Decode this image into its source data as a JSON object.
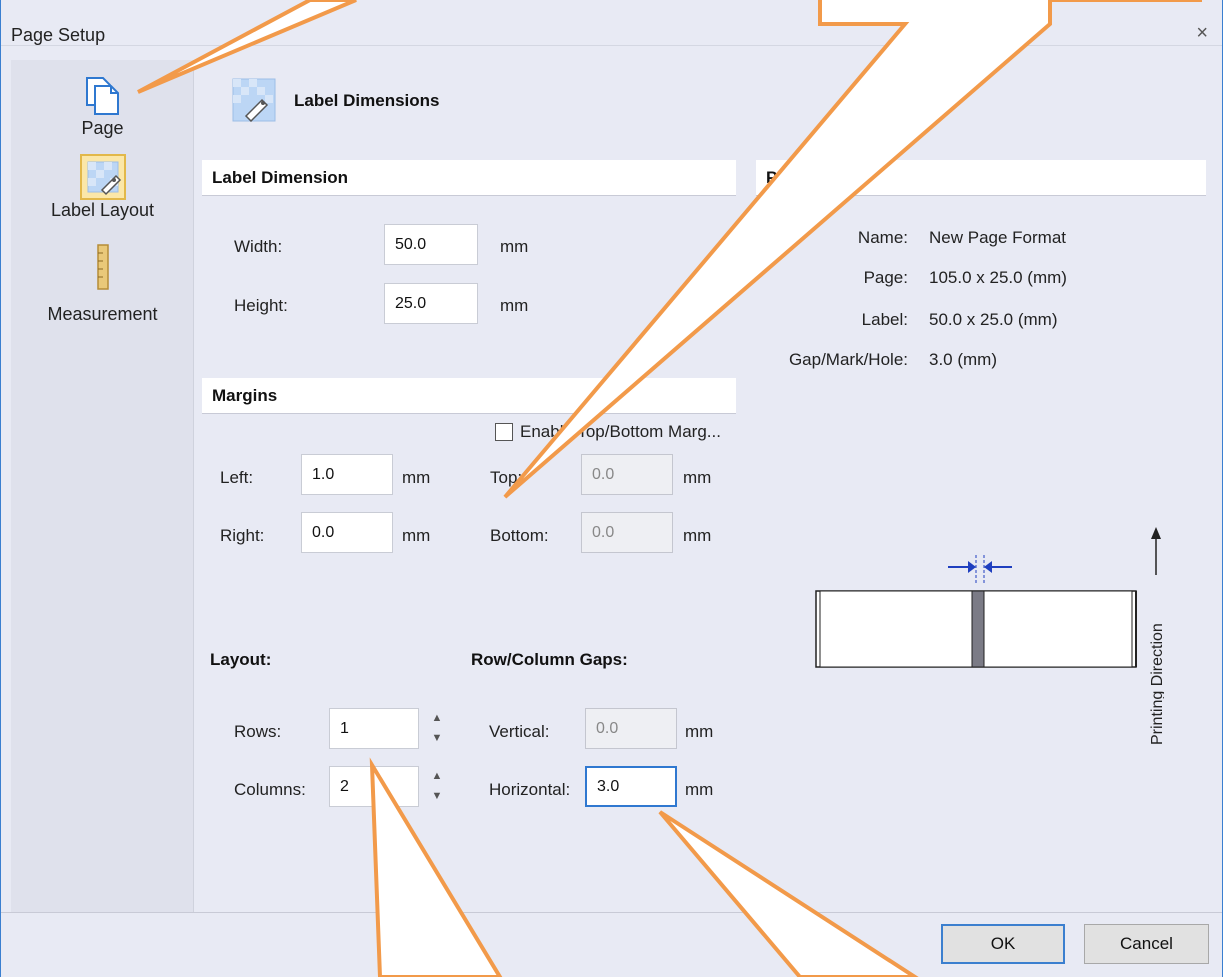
{
  "window": {
    "title": "Page Setup",
    "close_glyph": "×"
  },
  "sidebar": {
    "items": [
      {
        "label": "Page",
        "icon": "page-icon"
      },
      {
        "label": "Label Layout",
        "icon": "label-layout-icon",
        "selected": true
      },
      {
        "label": "Measurement",
        "icon": "ruler-icon"
      }
    ]
  },
  "header": {
    "title": "Label Dimensions",
    "icon": "label-dimensions-icon"
  },
  "label_dimension": {
    "title": "Label Dimension",
    "width_label": "Width:",
    "width_value": "50.0",
    "width_unit": "mm",
    "height_label": "Height:",
    "height_value": "25.0",
    "height_unit": "mm"
  },
  "margins": {
    "title": "Margins",
    "enable_label": "Enable Top/Bottom Marg...",
    "enable_checked": false,
    "left_label": "Left:",
    "left_value": "1.0",
    "left_unit": "mm",
    "right_label": "Right:",
    "right_value": "0.0",
    "right_unit": "mm",
    "top_label": "Top:",
    "top_value": "0.0",
    "top_unit": "mm",
    "bottom_label": "Bottom:",
    "bottom_value": "0.0",
    "bottom_unit": "mm"
  },
  "layout": {
    "title": "Layout:",
    "rows_label": "Rows:",
    "rows_value": "1",
    "columns_label": "Columns:",
    "columns_value": "2",
    "spin_up": "▲",
    "spin_down": "▼"
  },
  "gaps": {
    "title": "Row/Column Gaps:",
    "vertical_label": "Vertical:",
    "vertical_value": "0.0",
    "vertical_unit": "mm",
    "horizontal_label": "Horizontal:",
    "horizontal_value": "3.0",
    "horizontal_unit": "mm"
  },
  "preview": {
    "title_left": "P",
    "title_right": "iew",
    "name_label": "Name:",
    "name_value": "New Page Format",
    "page_label": "Page:",
    "page_value": "105.0 x 25.0 (mm)",
    "label_label": "Label:",
    "label_value": "50.0 x 25.0 (mm)",
    "gap_label": "Gap/Mark/Hole:",
    "gap_value": "3.0 (mm)",
    "direction_label": "Printing Direction"
  },
  "footer": {
    "ok_label": "OK",
    "cancel_label": "Cancel"
  },
  "colors": {
    "accent": "#2f78d0",
    "callout": "#f29a4a",
    "window_bg": "#e8eaf4"
  }
}
